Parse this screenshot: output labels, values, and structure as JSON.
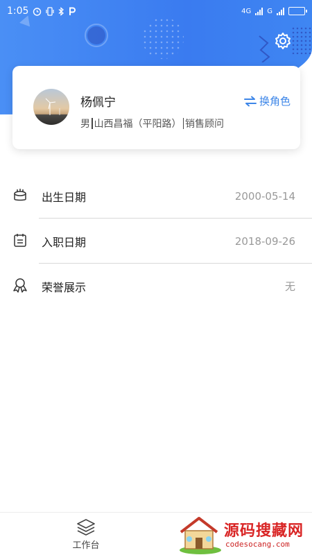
{
  "status_bar": {
    "time": "1:05",
    "net_label": "4G",
    "net_label2": "G"
  },
  "profile": {
    "name": "杨佩宁",
    "gender": "男",
    "store": "山西昌福（平阳路）",
    "position": "销售顾问",
    "switch_role_label": "换角色"
  },
  "info": [
    {
      "label": "出生日期",
      "value": "2000-05-14",
      "icon": "cake-icon"
    },
    {
      "label": "入职日期",
      "value": "2018-09-26",
      "icon": "calendar-icon"
    },
    {
      "label": "荣誉展示",
      "value": "无",
      "icon": "honor-ribbon-icon"
    }
  ],
  "tabbar": {
    "workbench_label": "工作台"
  },
  "watermark": {
    "title": "源码搜藏网",
    "url": "codesocang.com"
  },
  "colors": {
    "header_blue": "#3a7bf0",
    "accent": "#3d86e8",
    "battery_green": "#3cd05a",
    "watermark_red": "#d92525"
  }
}
